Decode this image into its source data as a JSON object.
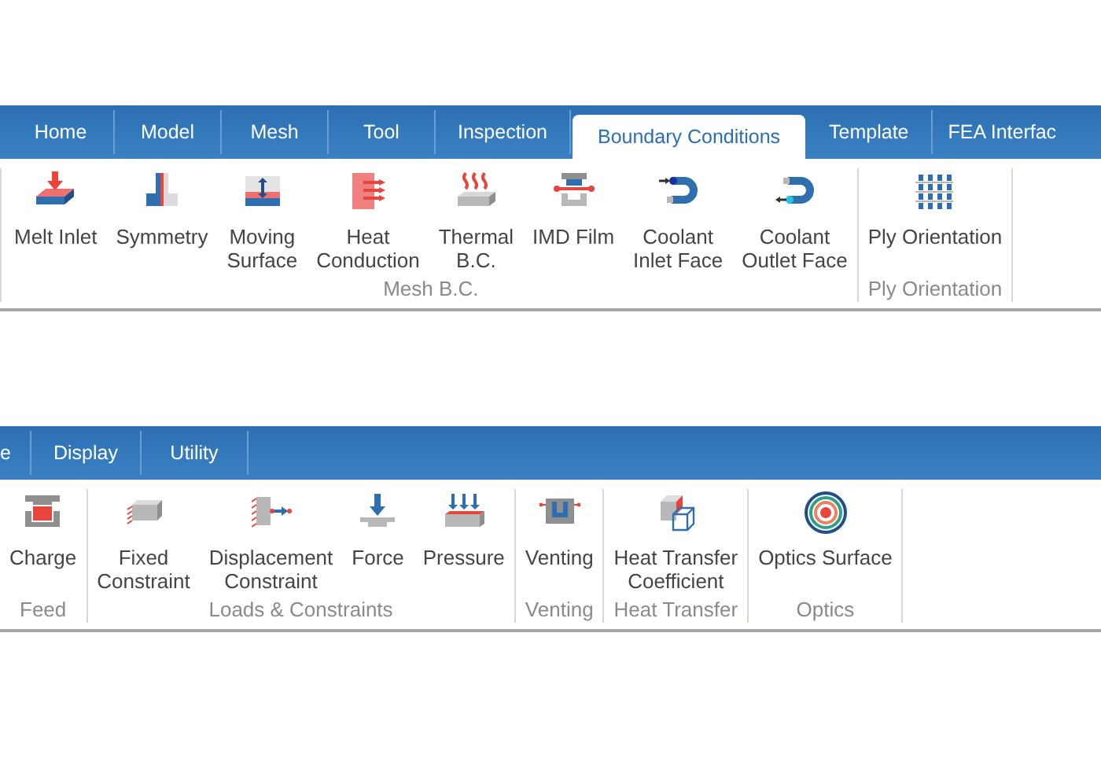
{
  "ribbons": [
    {
      "tabs": [
        {
          "label": "Home",
          "selected": false
        },
        {
          "label": "Model",
          "selected": false
        },
        {
          "label": "Mesh",
          "selected": false
        },
        {
          "label": "Tool",
          "selected": false
        },
        {
          "label": "Inspection",
          "selected": false
        },
        {
          "label": "Boundary Conditions",
          "selected": true
        },
        {
          "label": "Template",
          "selected": false
        },
        {
          "label": "FEA Interfac",
          "selected": false
        }
      ],
      "groups": [
        {
          "label": "Mesh B.C.",
          "items": [
            "Melt Inlet",
            "Symmetry",
            "Moving\nSurface",
            "Heat\nConduction",
            "Thermal\nB.C.",
            "IMD Film",
            "Coolant\nInlet Face",
            "Coolant\nOutlet Face"
          ]
        },
        {
          "label": "Ply Orientation",
          "items": [
            "Ply Orientation"
          ]
        }
      ]
    },
    {
      "tabs": [
        {
          "label": "e",
          "selected": false
        },
        {
          "label": "Display",
          "selected": false
        },
        {
          "label": "Utility",
          "selected": false
        }
      ],
      "groups": [
        {
          "label": "Feed",
          "items": [
            "Charge"
          ]
        },
        {
          "label": "Loads & Constraints",
          "items": [
            "Fixed\nConstraint",
            "Displacement\nConstraint",
            "Force",
            "Pressure"
          ]
        },
        {
          "label": "Venting",
          "items": [
            "Venting"
          ]
        },
        {
          "label": "Heat Transfer",
          "items": [
            "Heat Transfer\nCoefficient"
          ]
        },
        {
          "label": "Optics",
          "items": [
            "Optics Surface"
          ]
        }
      ]
    }
  ]
}
